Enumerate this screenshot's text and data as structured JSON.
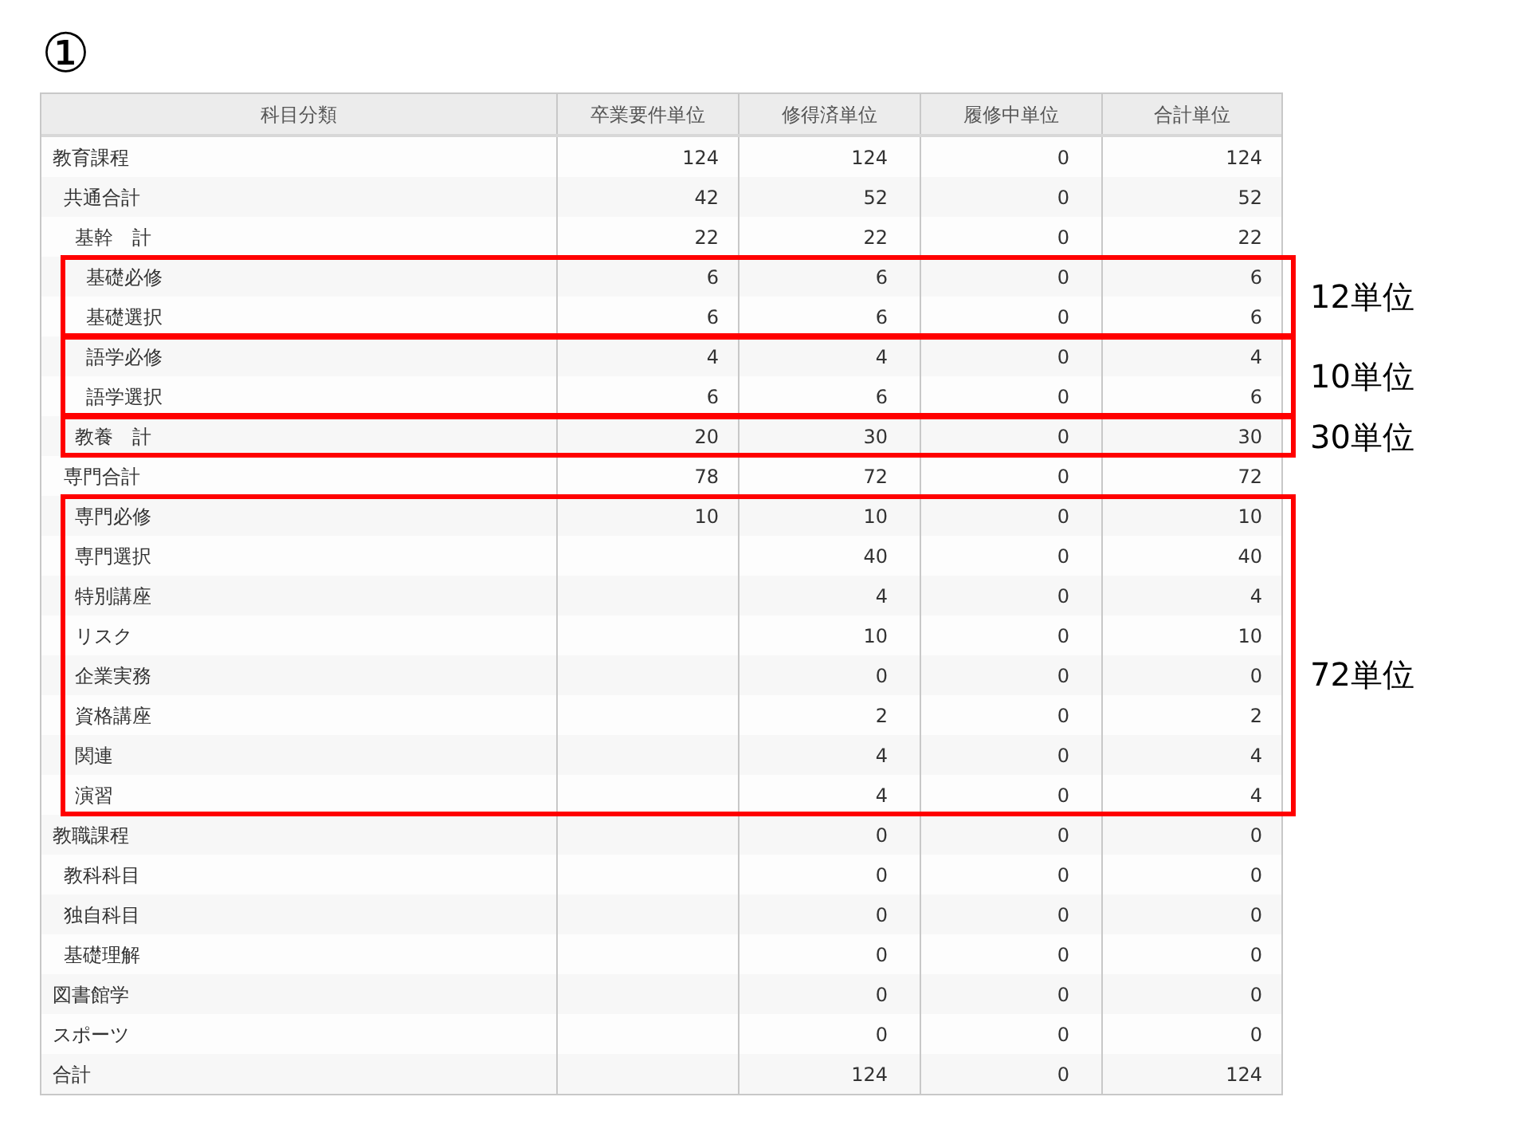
{
  "title": "①",
  "table": {
    "columns": [
      "科目分類",
      "卒業要件単位",
      "修得済単位",
      "履修中単位",
      "合計単位"
    ],
    "rows": [
      {
        "category": "教育課程",
        "required": "124",
        "earned": "124",
        "in_progress": "0",
        "total": "124",
        "children": [
          {
            "category": "共通合計",
            "required": "42",
            "earned": "52",
            "in_progress": "0",
            "total": "52",
            "children": [
              {
                "category": "基幹　計",
                "required": "22",
                "earned": "22",
                "in_progress": "0",
                "total": "22",
                "children": [
                  {
                    "category": "基礎必修",
                    "required": "6",
                    "earned": "6",
                    "in_progress": "0",
                    "total": "6",
                    "boxed": true,
                    "box_start": true
                  },
                  {
                    "category": "基礎選択",
                    "required": "6",
                    "earned": "6",
                    "in_progress": "0",
                    "total": "6",
                    "boxed": true
                  },
                  {
                    "category": "語学必修",
                    "required": "4",
                    "earned": "4",
                    "in_progress": "0",
                    "total": "4",
                    "boxed": true,
                    "box_start": true
                  },
                  {
                    "category": "語学選択",
                    "required": "6",
                    "earned": "6",
                    "in_progress": "0",
                    "total": "6",
                    "boxed": true
                  }
                ]
              },
              {
                "category": "教養　計",
                "required": "20",
                "earned": "30",
                "in_progress": "0",
                "total": "30",
                "boxed": true,
                "box_start": true
              }
            ]
          },
          {
            "category": "専門合計",
            "required": "78",
            "earned": "72",
            "in_progress": "0",
            "total": "72",
            "children": [
              {
                "category": "専門必修",
                "required": "10",
                "earned": "10",
                "in_progress": "0",
                "total": "10",
                "boxed": true,
                "box_start": true
              },
              {
                "category": "専門選択",
                "earned": "40",
                "in_progress": "0",
                "total": "40",
                "boxed": true
              },
              {
                "category": "特別講座",
                "earned": "4",
                "in_progress": "0",
                "total": "4",
                "boxed": true
              },
              {
                "category": "リスク",
                "earned": "10",
                "in_progress": "0",
                "total": "10",
                "boxed": true
              },
              {
                "category": "企業実務",
                "earned": "0",
                "in_progress": "0",
                "total": "0",
                "boxed": true
              },
              {
                "category": "資格講座",
                "earned": "2",
                "in_progress": "0",
                "total": "2",
                "boxed": true
              },
              {
                "category": "関連",
                "earned": "4",
                "in_progress": "0",
                "total": "4",
                "boxed": true
              },
              {
                "category": "演習",
                "earned": "4",
                "in_progress": "0",
                "total": "4",
                "boxed": true
              }
            ]
          }
        ]
      },
      {
        "category": "教職課程",
        "earned": "0",
        "in_progress": "0",
        "total": "0",
        "children": [
          {
            "category": "教科科目",
            "earned": "0",
            "in_progress": "0",
            "total": "0"
          },
          {
            "category": "独自科目",
            "earned": "0",
            "in_progress": "0",
            "total": "0"
          },
          {
            "category": "基礎理解",
            "earned": "0",
            "in_progress": "0",
            "total": "0"
          }
        ]
      },
      {
        "category": "図書館学",
        "earned": "0",
        "in_progress": "0",
        "total": "0"
      },
      {
        "category": "スポーツ",
        "earned": "0",
        "in_progress": "0",
        "total": "0"
      },
      {
        "category": "合計",
        "earned": "124",
        "in_progress": "0",
        "total": "124"
      }
    ]
  },
  "annotations": [
    {
      "label": "12単位"
    },
    {
      "label": "10単位"
    },
    {
      "label": "30単位"
    },
    {
      "label": "72単位"
    }
  ]
}
